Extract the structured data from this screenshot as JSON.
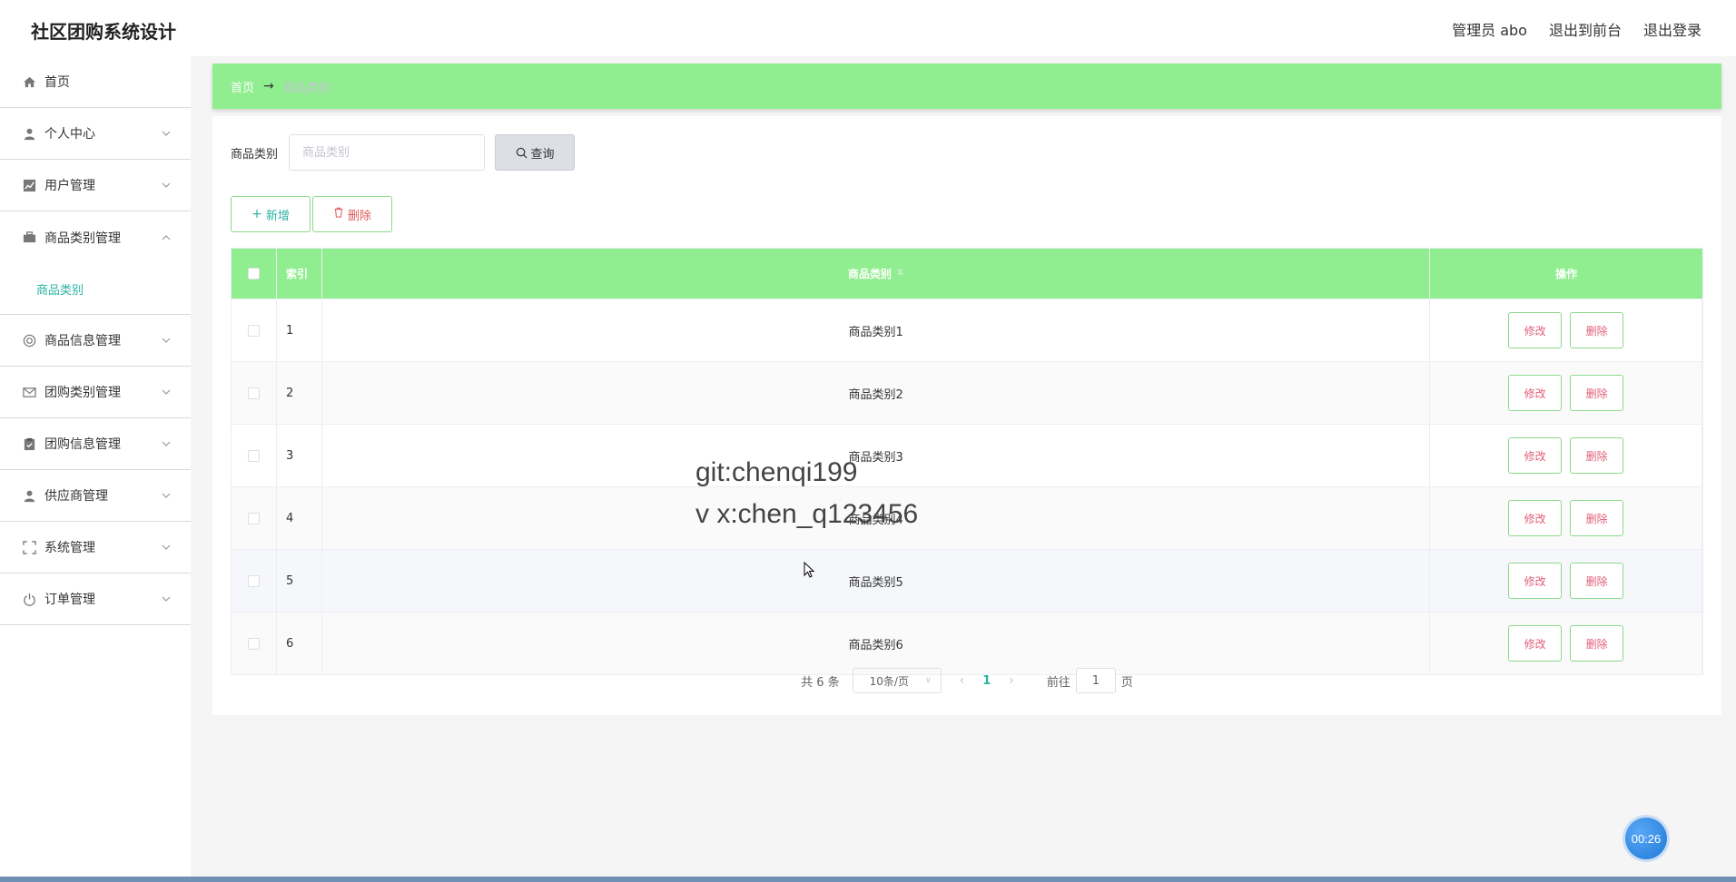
{
  "app": {
    "title": "社区团购系统设计"
  },
  "header": {
    "links": [
      "管理员 abo",
      "退出到前台",
      "退出登录"
    ]
  },
  "sidebar": {
    "items": [
      {
        "label": "首页",
        "icon": "home-icon",
        "expandable": false
      },
      {
        "label": "个人中心",
        "icon": "user-icon",
        "expandable": true
      },
      {
        "label": "用户管理",
        "icon": "chart-icon",
        "expandable": true
      },
      {
        "label": "商品类别管理",
        "icon": "briefcase-icon",
        "expandable": true,
        "open": true,
        "children": [
          "商品类别"
        ]
      },
      {
        "label": "商品信息管理",
        "icon": "lifebuoy-icon",
        "expandable": true
      },
      {
        "label": "团购类别管理",
        "icon": "mail-icon",
        "expandable": true
      },
      {
        "label": "团购信息管理",
        "icon": "clipboard-icon",
        "expandable": true
      },
      {
        "label": "供应商管理",
        "icon": "person-icon",
        "expandable": true
      },
      {
        "label": "系统管理",
        "icon": "fullscreen-icon",
        "expandable": true
      },
      {
        "label": "订单管理",
        "icon": "power-icon",
        "expandable": true
      }
    ]
  },
  "breadcrumb": {
    "home": "首页",
    "arrow": "→",
    "current": "商品类别"
  },
  "search": {
    "label": "商品类别",
    "placeholder": "商品类别",
    "value": "",
    "button": "查询"
  },
  "actions": {
    "add": "新增",
    "delete": "删除"
  },
  "table": {
    "columns": {
      "index": "索引",
      "name": "商品类别",
      "ops": "操作"
    },
    "rows": [
      {
        "index": "1",
        "name": "商品类别1"
      },
      {
        "index": "2",
        "name": "商品类别2"
      },
      {
        "index": "3",
        "name": "商品类别3"
      },
      {
        "index": "4",
        "name": "商品类别4"
      },
      {
        "index": "5",
        "name": "商品类别5"
      },
      {
        "index": "6",
        "name": "商品类别6"
      }
    ],
    "row_buttons": {
      "edit": "修改",
      "delete": "删除"
    }
  },
  "pagination": {
    "total": "共 6 条",
    "page_size": "10条/页",
    "current_page": "1",
    "goto_label": "前往",
    "goto_value": "1",
    "page_suffix": "页"
  },
  "watermark": {
    "line1": "git:chenqi199",
    "line2": "v x:chen_q123456"
  },
  "timer": {
    "text": "00:26"
  },
  "colors": {
    "accent_green": "#90ee90",
    "teal": "#2bb3a3",
    "danger": "#e0607a"
  }
}
